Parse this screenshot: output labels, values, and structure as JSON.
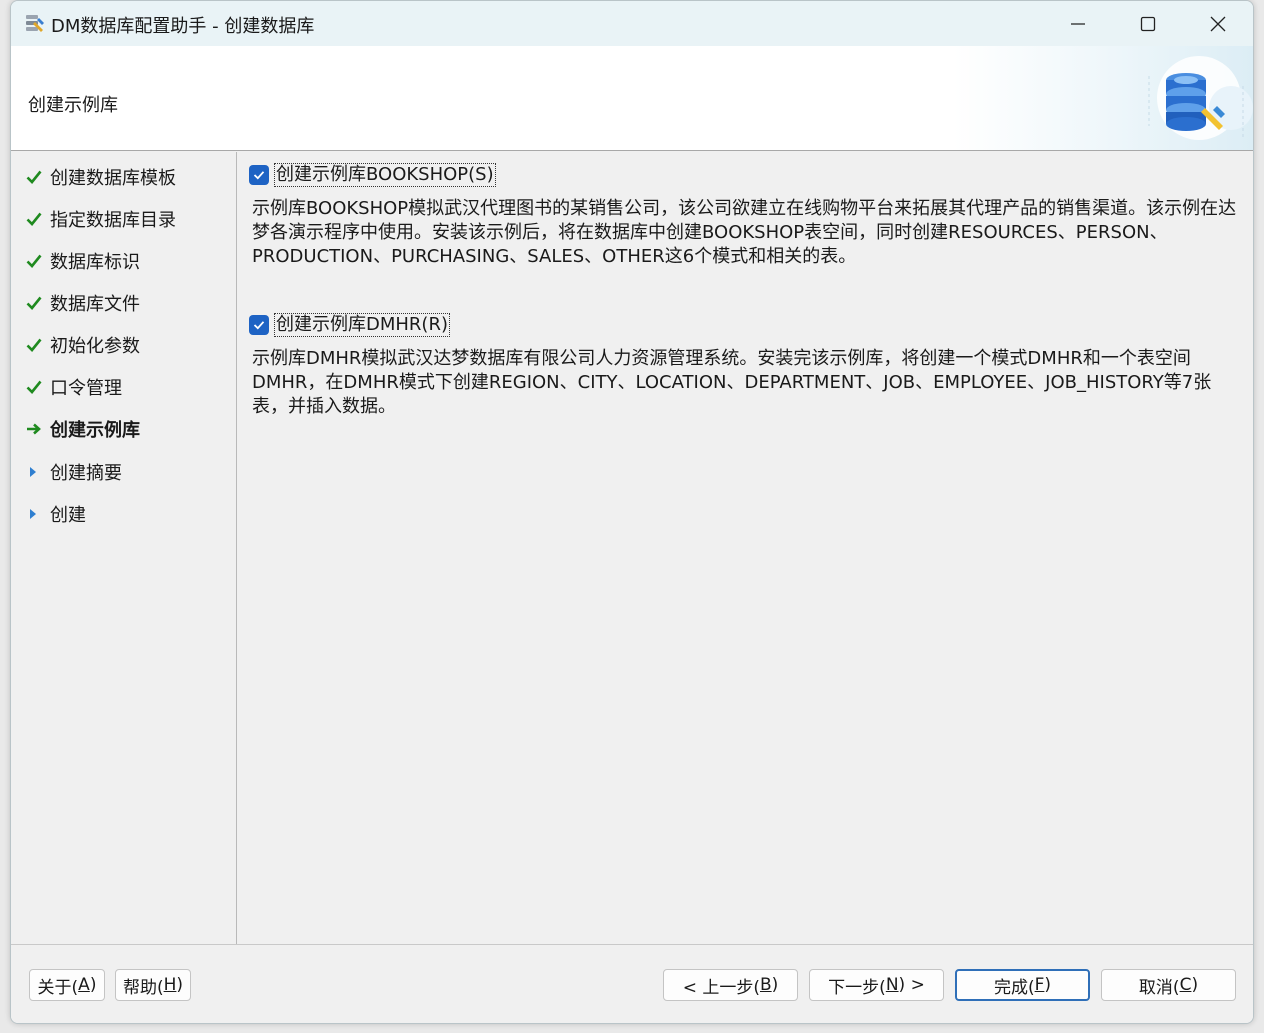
{
  "window": {
    "title": "DM数据库配置助手 - 创建数据库",
    "controls": {
      "minimize": "minimize-icon",
      "maximize": "maximize-icon",
      "close": "close-icon"
    }
  },
  "header": {
    "title": "创建示例库"
  },
  "sidebar": {
    "steps": [
      {
        "label": "创建数据库模板",
        "state": "done"
      },
      {
        "label": "指定数据库目录",
        "state": "done"
      },
      {
        "label": "数据库标识",
        "state": "done"
      },
      {
        "label": "数据库文件",
        "state": "done"
      },
      {
        "label": "初始化参数",
        "state": "done"
      },
      {
        "label": "口令管理",
        "state": "done"
      },
      {
        "label": "创建示例库",
        "state": "current"
      },
      {
        "label": "创建摘要",
        "state": "pending"
      },
      {
        "label": "创建",
        "state": "pending"
      }
    ]
  },
  "content": {
    "bookshop": {
      "checked": true,
      "label": "创建示例库BOOKSHOP(S)",
      "description": "示例库BOOKSHOP模拟武汉代理图书的某销售公司，该公司欲建立在线购物平台来拓展其代理产品的销售渠道。该示例在达梦各演示程序中使用。安装该示例后，将在数据库中创建BOOKSHOP表空间，同时创建RESOURCES、PERSON、PRODUCTION、PURCHASING、SALES、OTHER这6个模式和相关的表。"
    },
    "dmhr": {
      "checked": true,
      "label": "创建示例库DMHR(R)",
      "description": "示例库DMHR模拟武汉达梦数据库有限公司人力资源管理系统。安装完该示例库，将创建一个模式DMHR和一个表空间DMHR，在DMHR模式下创建REGION、CITY、LOCATION、DEPARTMENT、JOB、EMPLOYEE、JOB_HISTORY等7张表，并插入数据。"
    }
  },
  "footer": {
    "about": {
      "text": "关于(",
      "key": "A",
      "end": ")"
    },
    "help": {
      "text": "帮助(",
      "key": "H",
      "end": ")"
    },
    "prev": {
      "text": "< 上一步(",
      "key": "B",
      "end": ")"
    },
    "next": {
      "text": "下一步(",
      "key": "N",
      "end": ") >"
    },
    "finish": {
      "text": "完成(",
      "key": "F",
      "end": ")"
    },
    "cancel": {
      "text": "取消(",
      "key": "C",
      "end": ")"
    }
  },
  "colors": {
    "check_green": "#1f8a1f",
    "arrow_green": "#1f8a1f",
    "pending_blue": "#2f7fd0",
    "checkbox_blue": "#1e63c4"
  }
}
